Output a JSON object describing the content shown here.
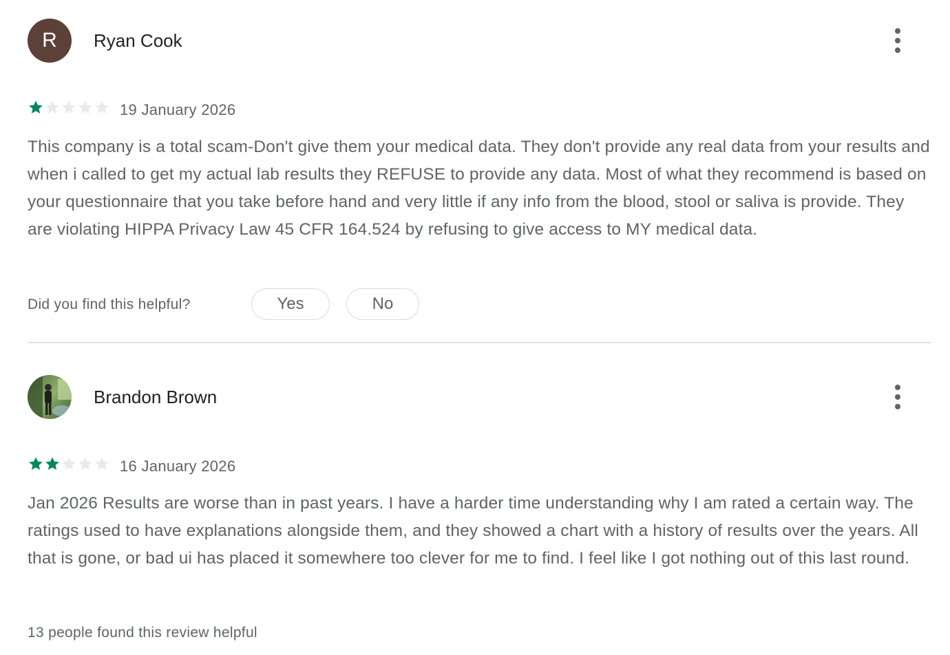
{
  "colors": {
    "star_filled": "#01875f",
    "star_empty": "#e8eaed",
    "avatar_letter_bg": "#5d4037",
    "text_secondary": "#5f6368",
    "text_primary": "#202124",
    "divider": "#e0e0e0"
  },
  "reviews": [
    {
      "author": "Ryan Cook",
      "avatar_letter": "R",
      "rating": 1,
      "max_rating": 5,
      "date": "19 January 2026",
      "text": "This company is a total scam-Don't give them your medical data. They don't provide any real data from your results and when i called to get my actual lab results they REFUSE to provide any data. Most of what they recommend is based on your questionnaire that you take before hand and very little if any info from the blood, stool or saliva is provide. They are violating HIPPA Privacy Law 45 CFR 164.524 by refusing to give access to MY medical data.",
      "helpful_question": "Did you find this helpful?",
      "yes_label": "Yes",
      "no_label": "No",
      "more_icon": "more-vert-icon"
    },
    {
      "author": "Brandon Brown",
      "avatar_icon": "profile-photo",
      "rating": 2,
      "max_rating": 5,
      "date": "16 January 2026",
      "text": "Jan 2026 Results are worse than in past years. I have a harder time understanding why I am rated a certain way. The ratings used to have explanations alongside them, and they showed a chart with a history of results over the years. All that is gone, or bad ui has placed it somewhere too clever for me to find. I feel like I got nothing out of this last round.",
      "helpful_count_text": "13 people found this review helpful",
      "more_icon": "more-vert-icon"
    }
  ]
}
